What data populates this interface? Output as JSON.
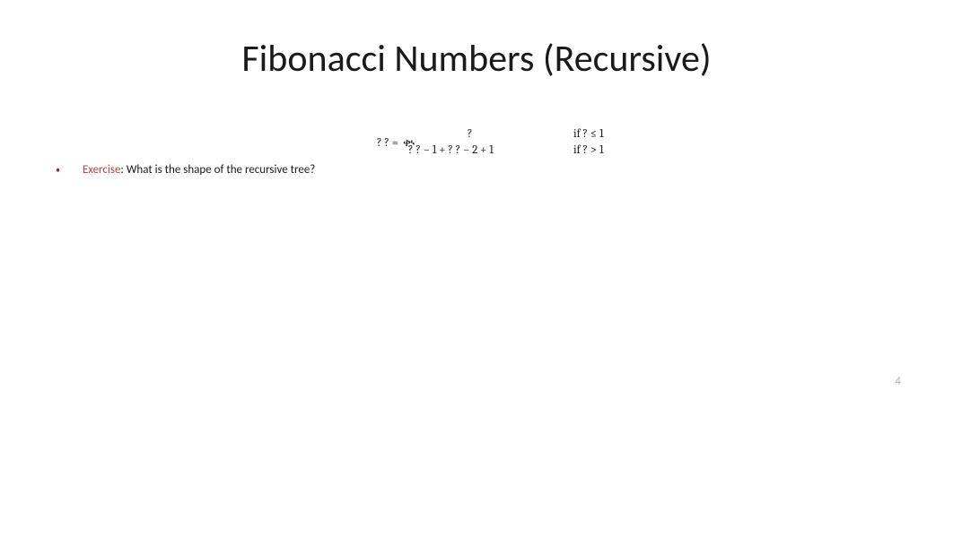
{
  "title": "Fibonacci Numbers (Recursive)",
  "formula": {
    "lhs": "?  ?   = ",
    "brace": "ቊ",
    "case1_expr": "?",
    "case1_cond": "if ? ≤ 1",
    "case2_expr": "?  ? − 1   + ?  ? − 2 + 1",
    "case2_cond": "if ? > 1"
  },
  "bullet": {
    "dot": "•",
    "label": "Exercise",
    "text": ": What is the shape of the recursive tree?"
  },
  "page_number": "4"
}
